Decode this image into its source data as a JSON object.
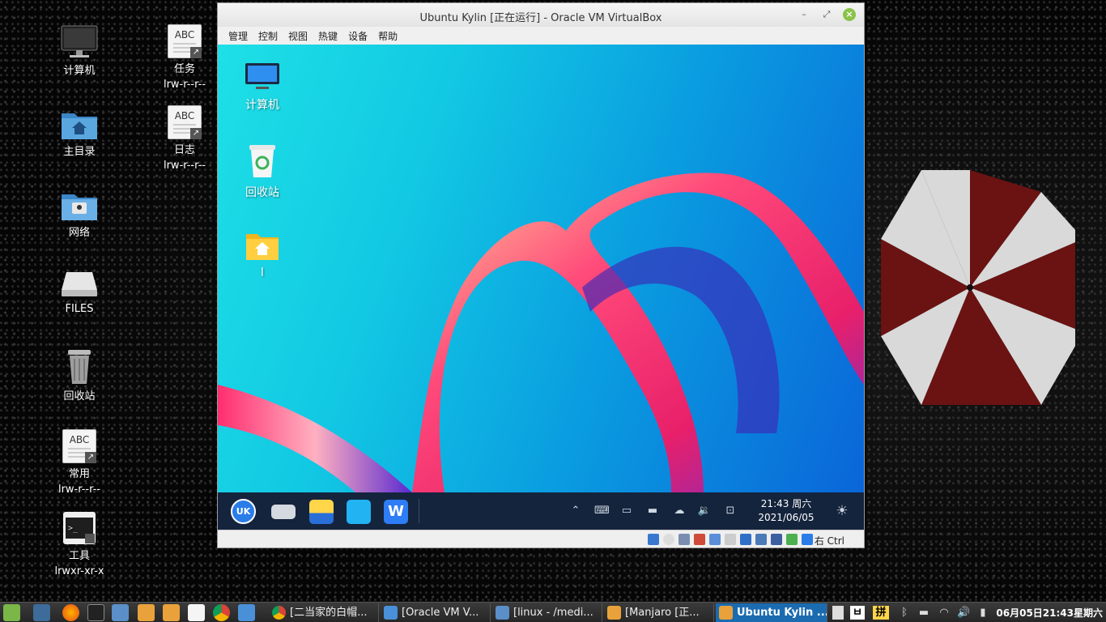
{
  "host_desktop": {
    "icons": [
      {
        "label": "计算机"
      },
      {
        "label": "主目录"
      },
      {
        "label": "网络"
      },
      {
        "label": "FILES"
      },
      {
        "label": "回收站"
      },
      {
        "label": "常用",
        "sub": "lrw-r--r--",
        "badge": "ABC"
      },
      {
        "label": "工具",
        "sub": "lrwxr-xr-x"
      },
      {
        "label": "任务",
        "sub": "lrw-r--r--",
        "badge": "ABC"
      },
      {
        "label": "日志",
        "sub": "lrw-r--r--",
        "badge": "ABC"
      }
    ]
  },
  "vbox": {
    "title": "Ubuntu Kylin [正在运行] - Oracle VM VirtualBox",
    "menu": [
      "管理",
      "控制",
      "视图",
      "热键",
      "设备",
      "帮助"
    ],
    "host_key": "右 Ctrl"
  },
  "guest": {
    "icons": [
      {
        "label": "计算机"
      },
      {
        "label": "回收站"
      },
      {
        "label": "l"
      }
    ],
    "start_label": "UK",
    "clock": {
      "time": "21:43 周六",
      "date": "2021/06/05"
    },
    "colors": {
      "taskbar": "#15243d",
      "accent_pink": "#e8206a"
    }
  },
  "panel": {
    "tasks": [
      {
        "label": "[二当家的白帽..."
      },
      {
        "label": "[Oracle VM V..."
      },
      {
        "label": "[linux - /medi..."
      },
      {
        "label": "[Manjaro [正..."
      },
      {
        "label": "Ubuntu Kylin ..."
      }
    ],
    "ime": "拼",
    "clock": "06月05日21:43星期六",
    "active_color": "#1b6bb0"
  }
}
